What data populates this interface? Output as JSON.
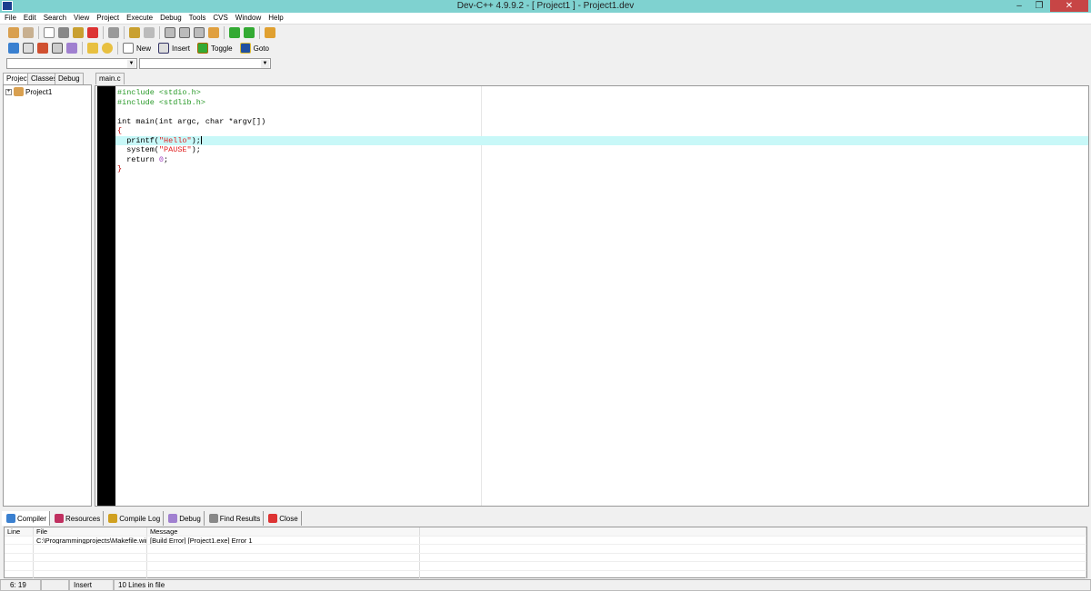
{
  "window": {
    "title": "Dev-C++ 4.9.9.2  -  [ Project1 ] - Project1.dev",
    "minimize": "–",
    "restore": "❐",
    "close": "✕"
  },
  "menu": [
    "File",
    "Edit",
    "Search",
    "View",
    "Project",
    "Execute",
    "Debug",
    "Tools",
    "CVS",
    "Window",
    "Help"
  ],
  "toolbar2": {
    "new": "New",
    "insert": "Insert",
    "toggle": "Toggle",
    "goto": "Goto"
  },
  "left_tabs": [
    "Project",
    "Classes",
    "Debug"
  ],
  "project_tree": {
    "expander": "+",
    "root": "Project1"
  },
  "editor": {
    "tab": "main.c",
    "lines": [
      [
        {
          "t": "#include <stdio.h>",
          "c": "pp"
        }
      ],
      [
        {
          "t": "#include <stdlib.h>",
          "c": "pp"
        }
      ],
      [],
      [
        {
          "t": "int main(int argc, char *argv[])",
          "c": "pl"
        }
      ],
      [
        {
          "t": "{",
          "c": "br"
        }
      ],
      [
        {
          "t": "  printf(",
          "c": "pl"
        },
        {
          "t": "\"Hello\"",
          "c": "str"
        },
        {
          "t": ");",
          "c": "pl"
        }
      ],
      [
        {
          "t": "  system(",
          "c": "pl"
        },
        {
          "t": "\"PAUSE\"",
          "c": "str"
        },
        {
          "t": ");",
          "c": "pl"
        }
      ],
      [
        {
          "t": "  return ",
          "c": "pl"
        },
        {
          "t": "0",
          "c": "num"
        },
        {
          "t": ";",
          "c": "pl"
        }
      ],
      [
        {
          "t": "}",
          "c": "br"
        }
      ]
    ]
  },
  "bottom_tabs": [
    "Compiler",
    "Resources",
    "Compile Log",
    "Debug",
    "Find Results",
    "Close"
  ],
  "messages": {
    "headers": [
      "Line",
      "File",
      "Message"
    ],
    "rows": [
      [
        "",
        "C:\\Programmingprojects\\Makefile.win",
        "[Build Error]  [Project1.exe] Error 1"
      ]
    ]
  },
  "status": {
    "position": "6: 19",
    "modified": "",
    "mode": "Insert",
    "info": "10 Lines in file"
  },
  "colors": {
    "titlebar": "#7fd2d0",
    "highlight": "#c8f8f8",
    "preprocessor": "#2a9a2a",
    "string": "#e02020"
  }
}
